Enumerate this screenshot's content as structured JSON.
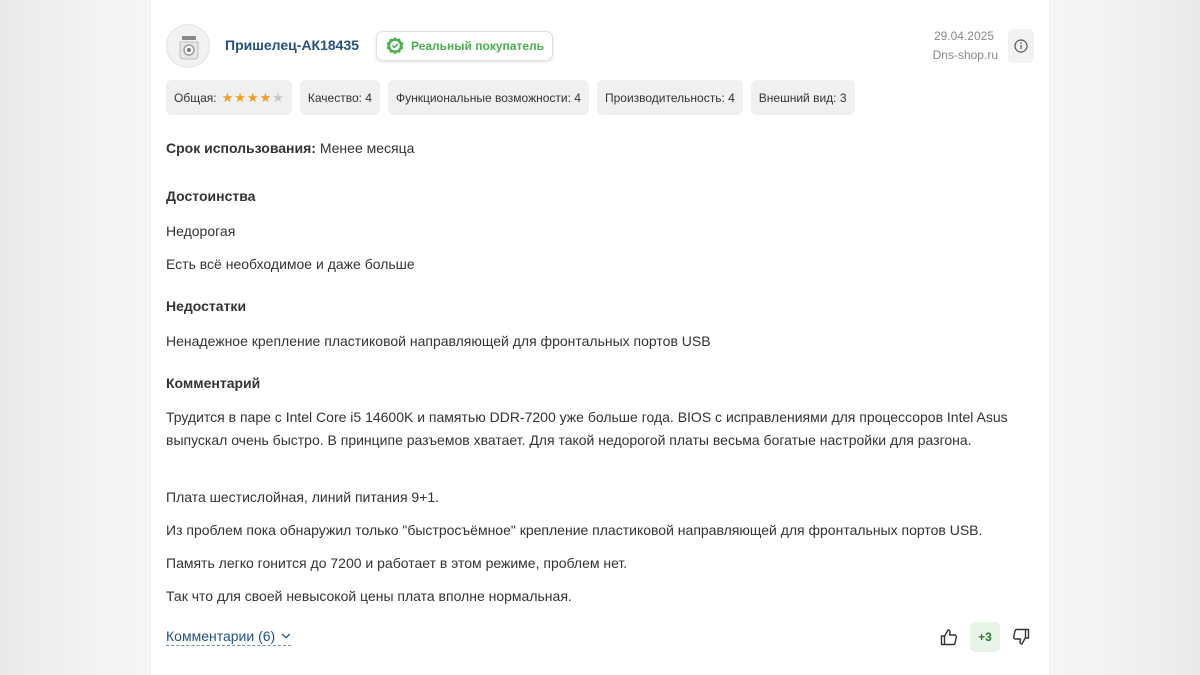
{
  "review": {
    "author": "Пришелец-АК18435",
    "badge": "Реальный покупатель",
    "date": "29.04.2025",
    "source": "Dns-shop.ru",
    "ratings": {
      "overall_label": "Общая:",
      "overall_stars": 4,
      "overall_max": 5,
      "chips": [
        "Качество: 4",
        "Функциональные возможности: 4",
        "Производительность: 4",
        "Внешний вид: 3"
      ]
    },
    "usage": {
      "label": "Срок использования:",
      "value": "Менее месяца"
    },
    "pros": {
      "heading": "Достоинства",
      "items": [
        "Недорогая",
        "Есть всё необходимое и даже больше"
      ]
    },
    "cons": {
      "heading": "Недостатки",
      "items": [
        "Ненадежное крепление пластиковой направляющей для фронтальных портов USB"
      ]
    },
    "comment": {
      "heading": "Комментарий",
      "paragraphs": [
        "Трудится в паре с Intel Core i5 14600K и памятью DDR-7200 уже больше года. BIOS с исправлениями для процессоров Intel Asus выпускал очень быстро. В принципе разъемов хватает. Для такой недорогой платы весьма богатые настройки для разгона.",
        "Плата шестислойная, линий питания 9+1.",
        "Из проблем пока обнаружил только \"быстросъёмное\" крепление пластиковой направляющей для фронтальных портов USB.",
        "Память легко гонится до 7200 и работает в этом режиме, проблем нет.",
        "Так что для своей невысокой цены плата вполне нормальная."
      ]
    },
    "footer": {
      "comments_label": "Комментарии (6)",
      "score": "+3"
    }
  },
  "colors": {
    "link": "#23527c",
    "badge_green": "#4caf50",
    "star": "#f29b1e",
    "score_bg": "#e8f4e8"
  },
  "icons": [
    "avatar-icon",
    "verified-icon",
    "info-icon",
    "star-icon",
    "chevron-down-icon",
    "thumbs-up-icon",
    "thumbs-down-icon"
  ]
}
